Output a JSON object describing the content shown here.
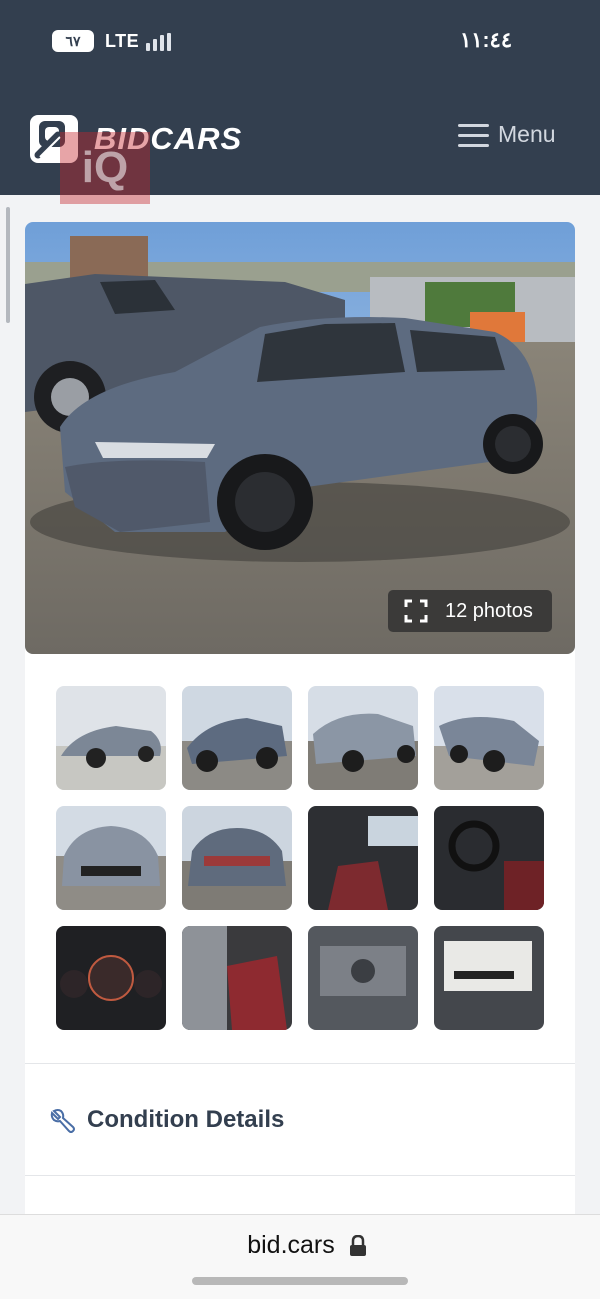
{
  "status_bar": {
    "battery": "٦٧",
    "network": "LTE",
    "time": "١١:٤٤"
  },
  "header": {
    "logo_text": "BIDCARS",
    "watermark_text": "iQ",
    "menu_label": "Menu"
  },
  "gallery": {
    "photos_label": "12 photos",
    "thumbnail_count": 12,
    "thumbnails": [
      "exterior-front-left",
      "exterior-rear-left",
      "exterior-rear-right",
      "exterior-front-right",
      "exterior-front",
      "exterior-rear",
      "interior-front-seats",
      "interior-dashboard",
      "instrument-cluster",
      "interior-rear-seats",
      "engine-bay",
      "vin-label"
    ]
  },
  "sections": {
    "condition_title": "Condition Details"
  },
  "browser": {
    "url": "bid.cars"
  },
  "colors": {
    "header_bg": "#333f4f",
    "page_bg": "#f2f3f5",
    "card_bg": "#ffffff",
    "title_text": "#333f4f",
    "car_paint": "#5d6b80"
  },
  "icons": {
    "menu": "hamburger-icon",
    "photos": "expand-icon",
    "condition": "wrench-icon",
    "lock": "lock-icon"
  }
}
